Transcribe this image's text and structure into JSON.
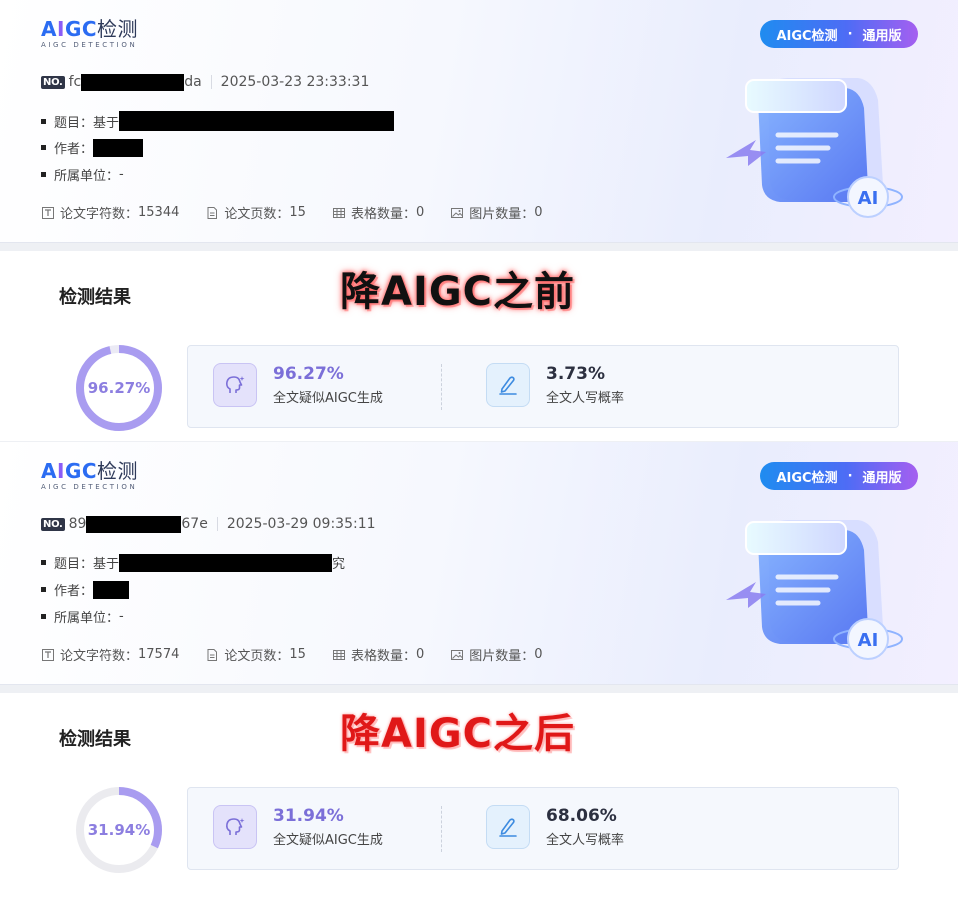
{
  "reports": [
    {
      "logo": {
        "a": "A",
        "i": "I",
        "gc": "GC",
        "cn": "检测",
        "sub": "AIGC DETECTION"
      },
      "badge": {
        "left": "AIGC检测",
        "dot": "·",
        "right": "通用版"
      },
      "no_tag": "NO.",
      "id_prefix": "fc",
      "id_suffix": "da",
      "datetime": "2025-03-23 23:33:31",
      "title_label": "题目：",
      "title_prefix": "基于",
      "title_suffix": "",
      "author_label": "作者：",
      "org_label": "所属单位：",
      "org_value": "-",
      "stats": {
        "chars_label": "论文字符数：",
        "chars": "15344",
        "pages_label": "论文页数：",
        "pages": "15",
        "tables_label": "表格数量：",
        "tables": "0",
        "images_label": "图片数量：",
        "images": "0"
      },
      "result_title": "检测结果",
      "stamp": "降AIGC之前",
      "ring_value": 96.27,
      "ring_text": "96.27%",
      "ai_value": "96.27%",
      "ai_label": "全文疑似AIGC生成",
      "human_value": "3.73%",
      "human_label": "全文人写概率",
      "colors": {
        "ring": "#a99cf0",
        "ring_track": "#ebeaf5"
      }
    },
    {
      "logo": {
        "a": "A",
        "i": "I",
        "gc": "GC",
        "cn": "检测",
        "sub": "AIGC DETECTION"
      },
      "badge": {
        "left": "AIGC检测",
        "dot": "·",
        "right": "通用版"
      },
      "no_tag": "NO.",
      "id_prefix": "89",
      "id_suffix": "67e",
      "datetime": "2025-03-29 09:35:11",
      "title_label": "题目：",
      "title_prefix": "基于",
      "title_suffix": "究",
      "author_label": "作者：",
      "org_label": "所属单位：",
      "org_value": "-",
      "stats": {
        "chars_label": "论文字符数：",
        "chars": "17574",
        "pages_label": "论文页数：",
        "pages": "15",
        "tables_label": "表格数量：",
        "tables": "0",
        "images_label": "图片数量：",
        "images": "0"
      },
      "result_title": "检测结果",
      "stamp": "降AIGC之后",
      "ring_value": 31.94,
      "ring_text": "31.94%",
      "ai_value": "31.94%",
      "ai_label": "全文疑似AIGC生成",
      "human_value": "68.06%",
      "human_label": "全文人写概率",
      "colors": {
        "ring": "#a99cf0",
        "ring_track": "#ebebef"
      }
    }
  ]
}
